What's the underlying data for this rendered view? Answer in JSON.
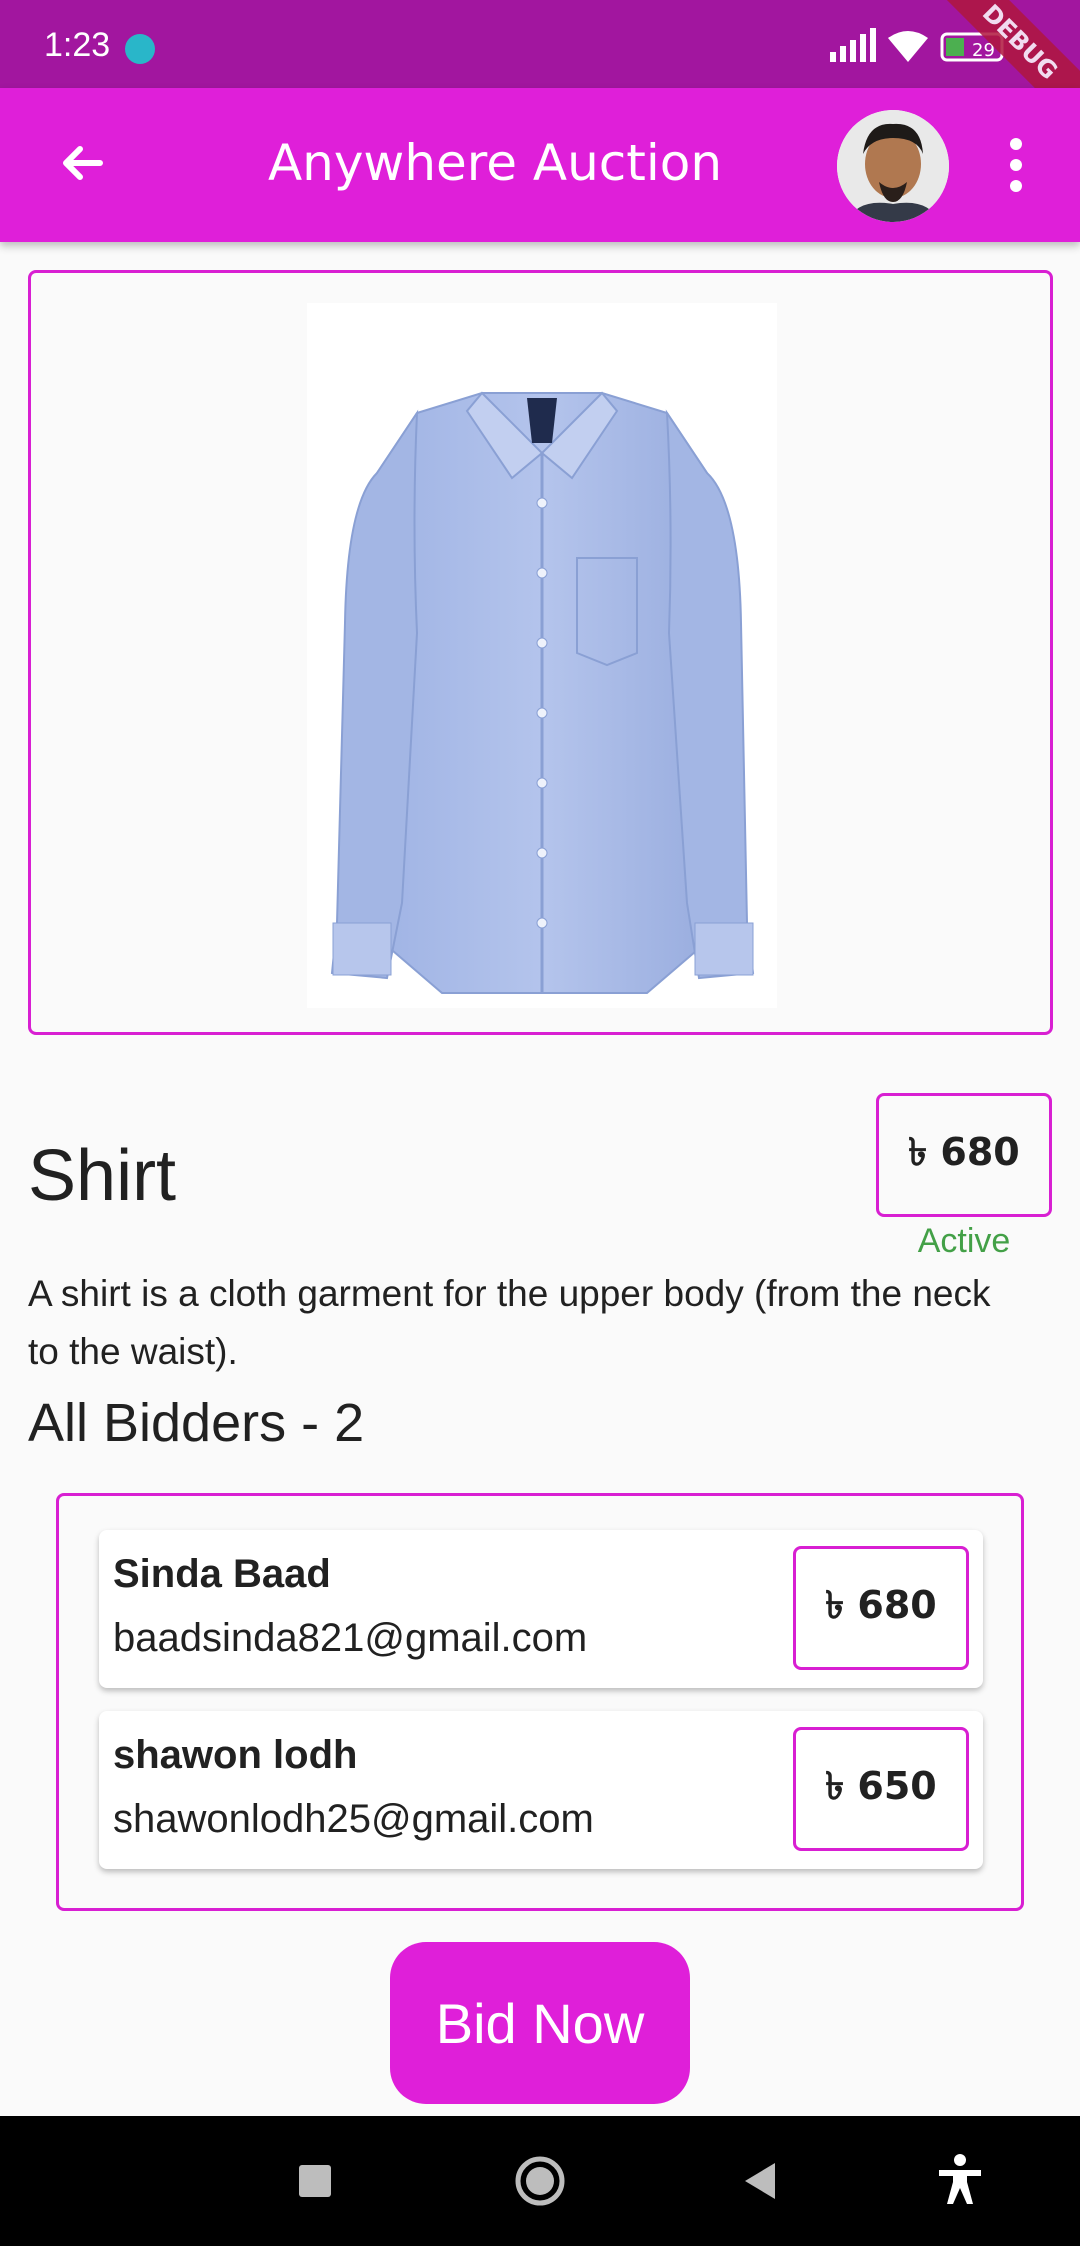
{
  "status_bar": {
    "time": "1:23",
    "battery": "29",
    "debug_label": "DEBUG"
  },
  "app_bar": {
    "title": "Anywhere Auction"
  },
  "product": {
    "title": "Shirt",
    "price": "৳ 680",
    "status": "Active",
    "description": "A shirt is a cloth garment for the upper body (from the neck to the waist)."
  },
  "bidders": {
    "heading": "All Bidders  - 2",
    "items": [
      {
        "name": "Sinda Baad",
        "email": "baadsinda821@gmail.com",
        "amount": "৳ 680"
      },
      {
        "name": "shawon lodh",
        "email": "shawonlodh25@gmail.com",
        "amount": "৳ 650"
      }
    ]
  },
  "actions": {
    "bid_label": "Bid Now"
  },
  "colors": {
    "status_bar": "#a2169f",
    "app_bar": "#df1fd9",
    "border": "#d81fd2",
    "active": "#43a047"
  }
}
